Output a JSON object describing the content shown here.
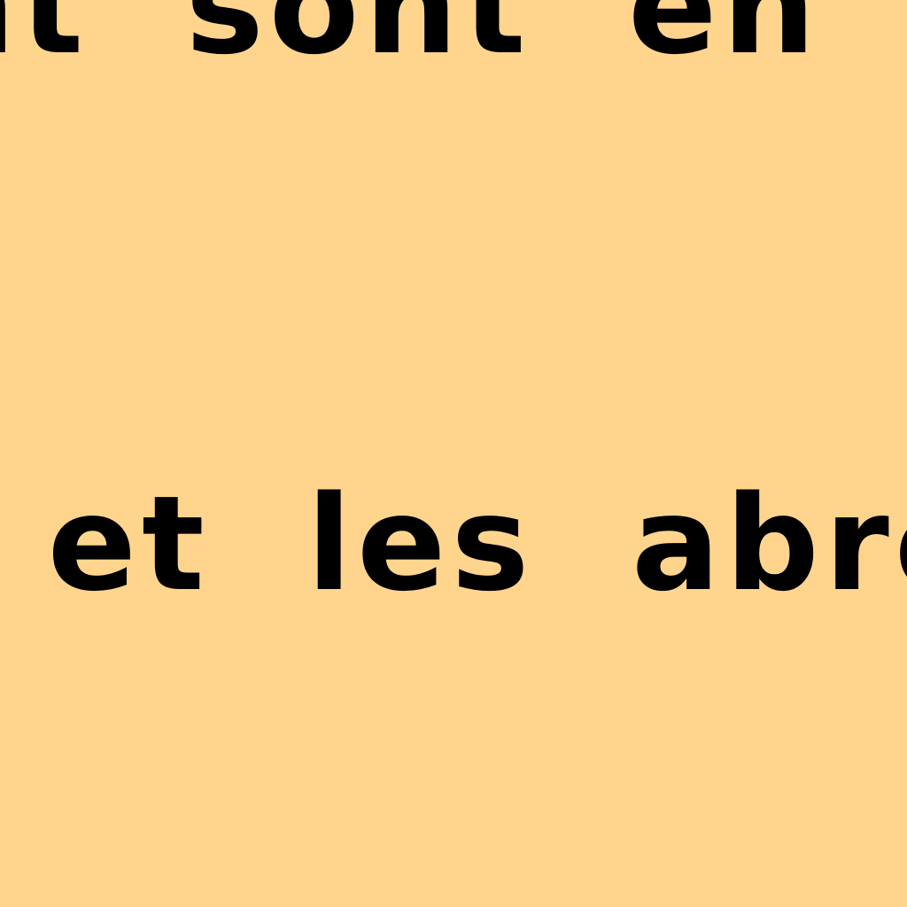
{
  "background_color": "#FFD58E",
  "text_color": "#000000",
  "document": {
    "line_1": "nt sont en piec",
    "line_2": "s et les abrévia"
  }
}
